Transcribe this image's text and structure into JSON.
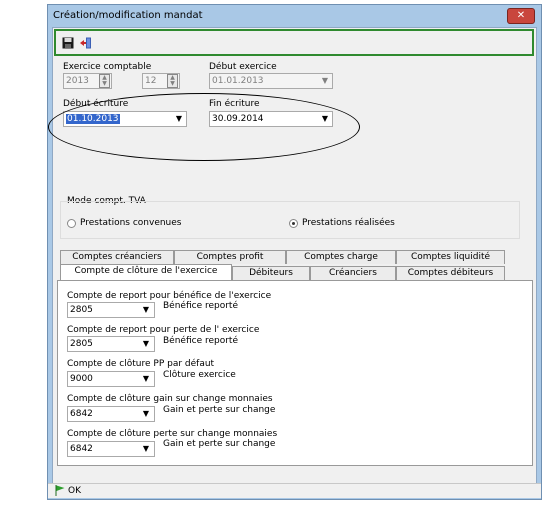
{
  "window": {
    "title": "Création/modification mandat",
    "close_label": "✕"
  },
  "toolbar": {
    "save_icon": "save-icon",
    "exit_icon": "exit-door-icon"
  },
  "fields": {
    "exercice_label": "Exercice comptable",
    "exercice_year": "2013",
    "exercice_month": "12",
    "debut_exercice_label": "Début exercice",
    "debut_exercice_value": "01.01.2013",
    "debut_ecriture_label": "Début écriture",
    "debut_ecriture_value": "01.10.2013",
    "fin_ecriture_label": "Fin écriture",
    "fin_ecriture_value": "30.09.2014"
  },
  "tva": {
    "group_label": "Mode compt. TVA",
    "option1": "Prestations convenues",
    "option2": "Prestations réalisées",
    "selected": "option2"
  },
  "tabs_row1": [
    "Comptes créanciers",
    "Comptes profit",
    "Comptes charge",
    "Comptes liquidité"
  ],
  "tabs_row2": [
    "Compte de clôture de l'exercice",
    "Débiteurs",
    "Créanciers",
    "Comptes débiteurs"
  ],
  "active_tab": "Compte de clôture de l'exercice",
  "closing": [
    {
      "label": "Compte de report pour bénéfice de l'exercice",
      "value": "2805",
      "desc": "Bénéfice reporté"
    },
    {
      "label": "Compte de report pour perte de l' exercice",
      "value": "2805",
      "desc": "Bénéfice reporté"
    },
    {
      "label": "Compte de clôture PP par défaut",
      "value": "9000",
      "desc": "Clôture exercice"
    },
    {
      "label": "Compte de clôture gain sur change monnaies",
      "value": "6842",
      "desc": "Gain et perte sur change"
    },
    {
      "label": "Compte de clôture perte sur change monnaies",
      "value": "6842",
      "desc": "Gain et perte sur change"
    }
  ],
  "status": {
    "ok_label": "OK",
    "flag_color": "#2e9e2e"
  }
}
